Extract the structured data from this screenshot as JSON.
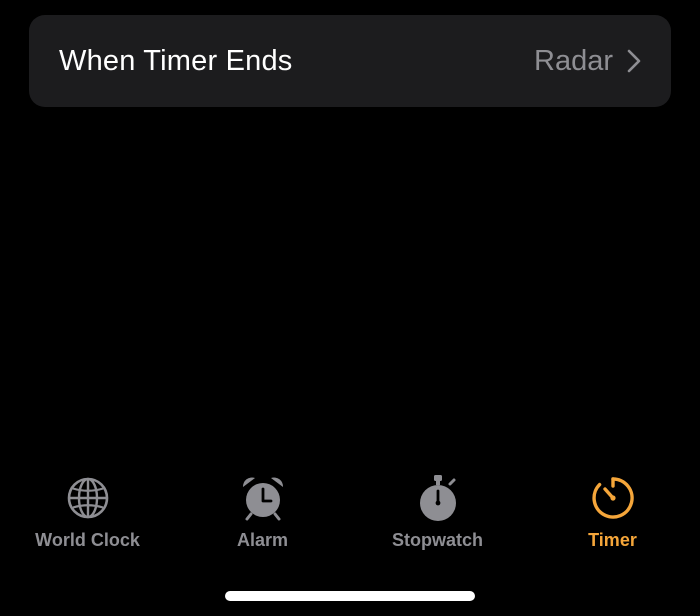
{
  "setting": {
    "label": "When Timer Ends",
    "value": "Radar",
    "chevron_icon": "chevron-right-icon"
  },
  "tabs": [
    {
      "label": "World Clock",
      "icon": "globe-icon",
      "active": false
    },
    {
      "label": "Alarm",
      "icon": "alarm-clock-icon",
      "active": false
    },
    {
      "label": "Stopwatch",
      "icon": "stopwatch-icon",
      "active": false
    },
    {
      "label": "Timer",
      "icon": "timer-icon",
      "active": true
    }
  ],
  "colors": {
    "background": "#000000",
    "row_background": "#1c1c1e",
    "inactive": "#8e8e93",
    "accent": "#f5a63a",
    "home_indicator": "#ffffff"
  }
}
